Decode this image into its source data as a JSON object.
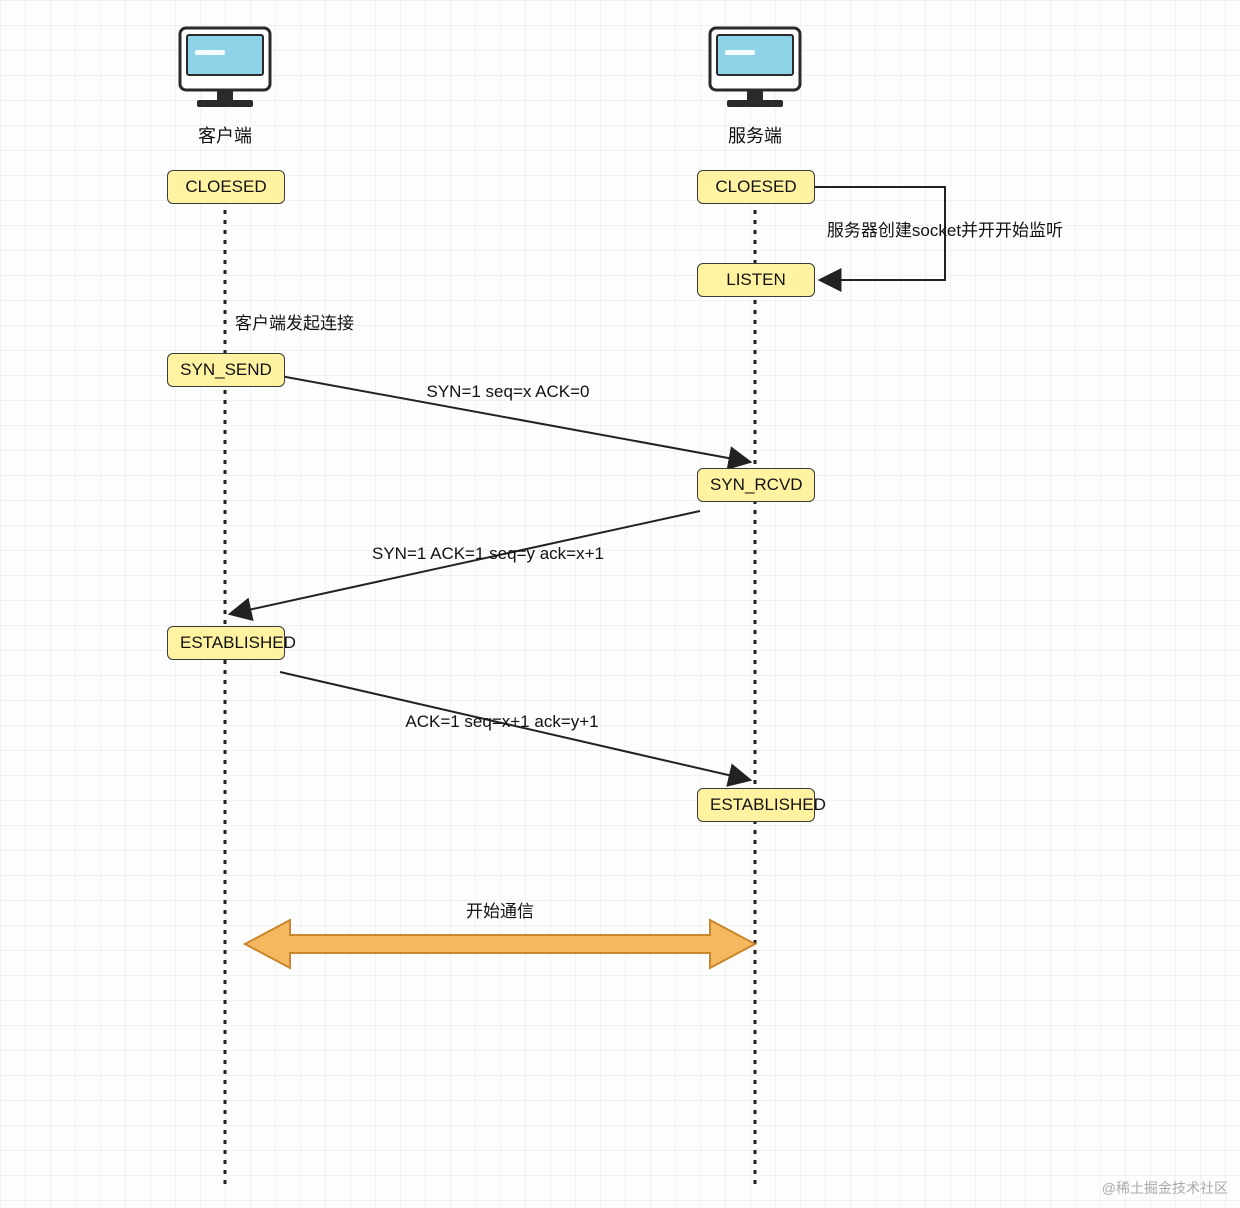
{
  "actors": {
    "client": {
      "title": "客户端"
    },
    "server": {
      "title": "服务端"
    }
  },
  "states": {
    "client_closed": "CLOESED",
    "server_closed": "CLOESED",
    "server_listen": "LISTEN",
    "client_syn_send": "SYN_SEND",
    "server_syn_rcvd": "SYN_RCVD",
    "client_established": "ESTABLISHED",
    "server_established": "ESTABLISHED"
  },
  "annotations": {
    "server_create_socket": "服务器创建socket并开开始监听",
    "client_initiate": "客户端发起连接",
    "msg1": "SYN=1 seq=x ACK=0",
    "msg2": "SYN=1 ACK=1 seq=y ack=x+1",
    "msg3": "ACK=1 seq=x+1 ack=y+1",
    "start_comm": "开始通信"
  },
  "colors": {
    "box_fill": "#fff3a2",
    "box_stroke": "#3a3a3a",
    "monitor_screen": "#8fd3e8",
    "arrow_comm": "#eda93f",
    "arrow_line": "#222222"
  },
  "watermark": "@稀土掘金技术社区"
}
